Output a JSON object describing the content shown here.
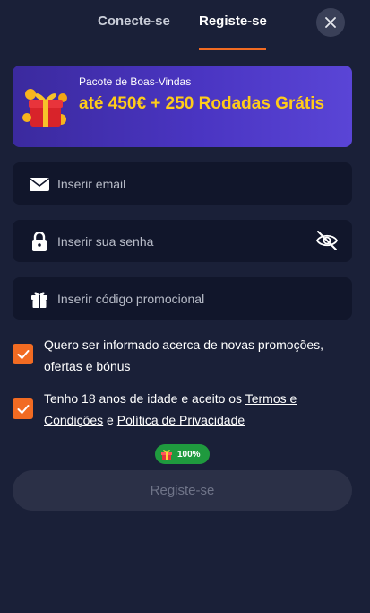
{
  "tabs": {
    "login_label": "Conecte-se",
    "register_label": "Registe-se"
  },
  "banner": {
    "kicker": "Pacote de Boas-Vindas",
    "headline": "até 450€ + 250 Rodadas Grátis"
  },
  "fields": {
    "email_placeholder": "Inserir email",
    "password_placeholder": "Inserir sua senha",
    "promo_placeholder": "Inserir código promocional"
  },
  "checkboxes": {
    "marketing_text": "Quero ser informado acerca de novas promoções, ofertas e bónus",
    "age_prefix": "Tenho 18 anos de idade e aceito os ",
    "terms_link": "Termos e Condições",
    "and_word": " e ",
    "privacy_link": "Política de Privacidade"
  },
  "progress_badge": {
    "text": "100%",
    "value": 1.0
  },
  "submit_label": "Registe-se",
  "colors": {
    "background": "#1a2038",
    "accent": "#f26b22",
    "field_bg": "#11162b",
    "banner_text": "#ffcc1a",
    "badge": "#1f9a3e"
  },
  "icons": [
    "close-icon",
    "gift-banner-icon",
    "envelope-icon",
    "lock-icon",
    "eye-slash-icon",
    "gift-icon",
    "checkmark-icon"
  ]
}
